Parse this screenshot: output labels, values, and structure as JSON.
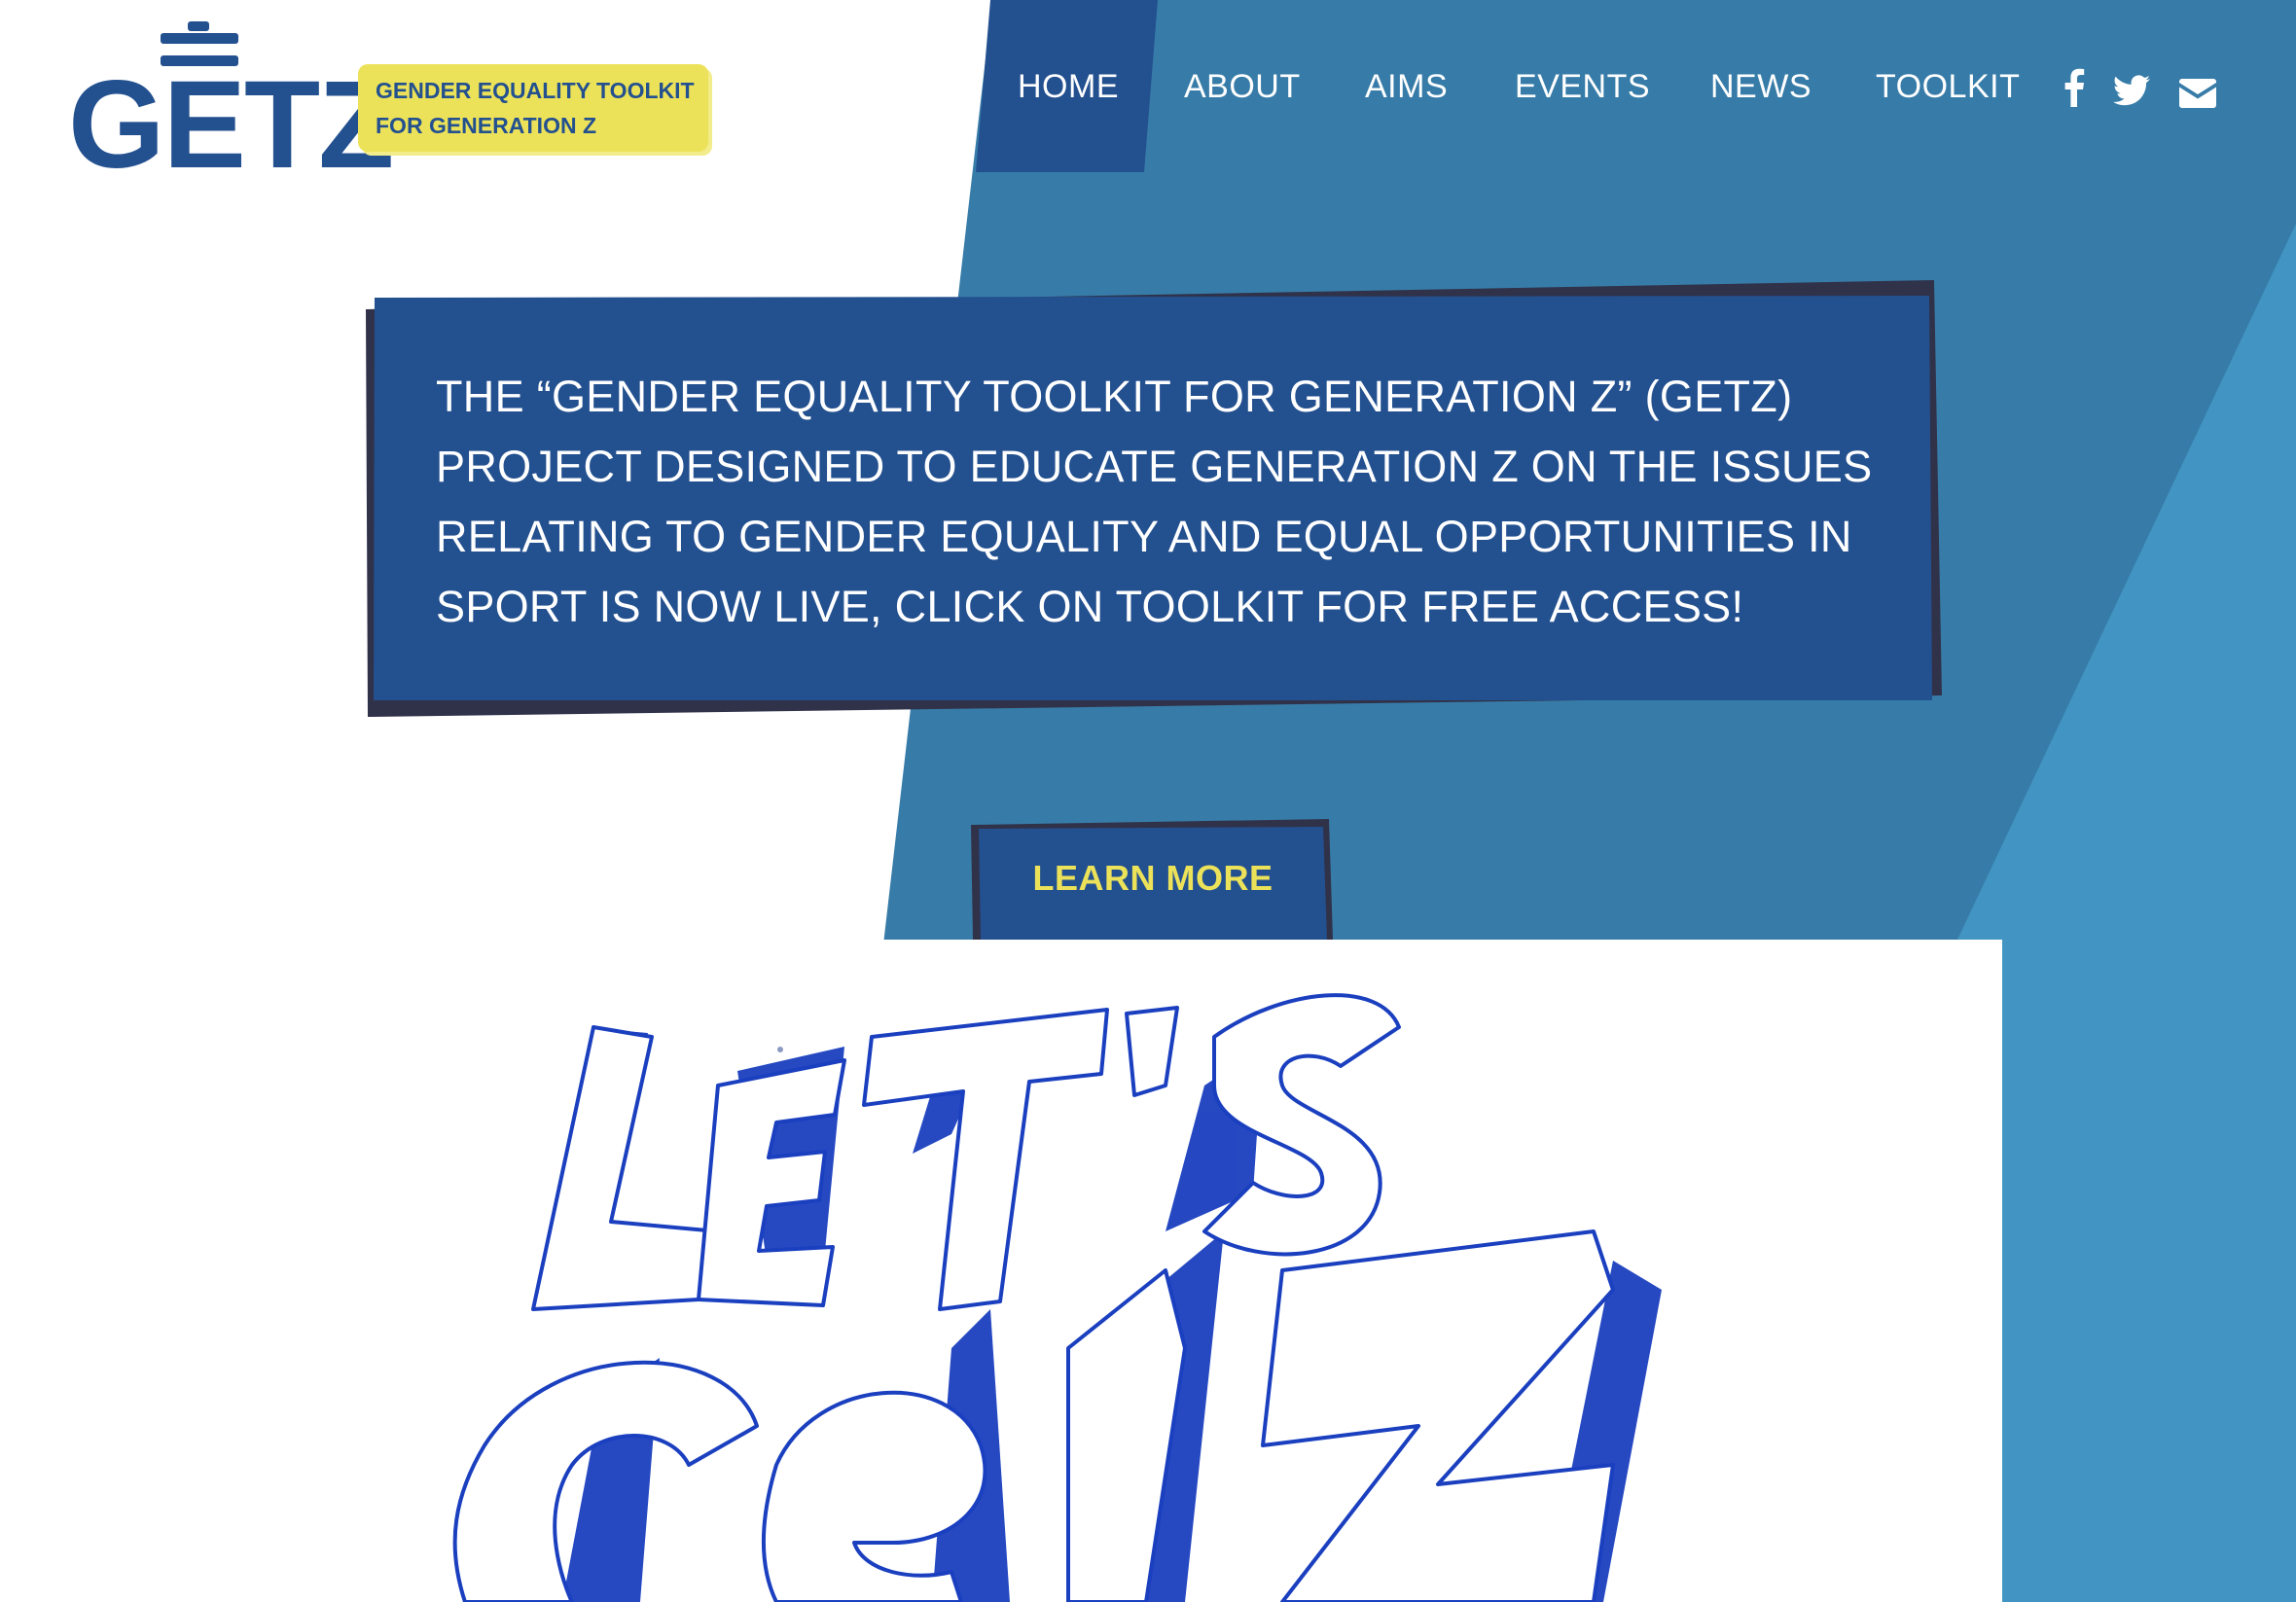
{
  "brand": {
    "logo_text": "GETZ",
    "tagline_line1": "GENDER EQUALITY TOOLKIT",
    "tagline_line2": "FOR GENERATION Z"
  },
  "nav": {
    "items": [
      {
        "label": "HOME",
        "active": true
      },
      {
        "label": "ABOUT",
        "active": false
      },
      {
        "label": "AIMS",
        "active": false
      },
      {
        "label": "EVENTS",
        "active": false
      },
      {
        "label": "NEWS",
        "active": false
      },
      {
        "label": "TOOLKIT",
        "active": false
      }
    ],
    "social": [
      {
        "icon": "facebook-icon"
      },
      {
        "icon": "twitter-icon"
      },
      {
        "icon": "email-icon"
      }
    ]
  },
  "announcement": {
    "lines": [
      "THE “GENDER EQUALITY TOOLKIT FOR GENERATION Z” (GETZ)",
      "PROJECT DESIGNED TO EDUCATE GENERATION Z ON THE ISSUES",
      "RELATING TO GENDER EQUALITY AND EQUAL OPPORTUNITIES IN",
      "SPORT IS NOW LIVE, CLICK ON TOOLKIT FOR FREE ACCESS!"
    ]
  },
  "cta": {
    "label": "LEARN MORE"
  },
  "artwork": {
    "text": "LET'S GETZ"
  },
  "colors": {
    "navy": "#23508f",
    "mid_blue": "#377ca8",
    "light_blue": "#4295c2",
    "yellow": "#ece25a",
    "ink_blue": "#1a3fbf",
    "shadow": "#30324a"
  }
}
